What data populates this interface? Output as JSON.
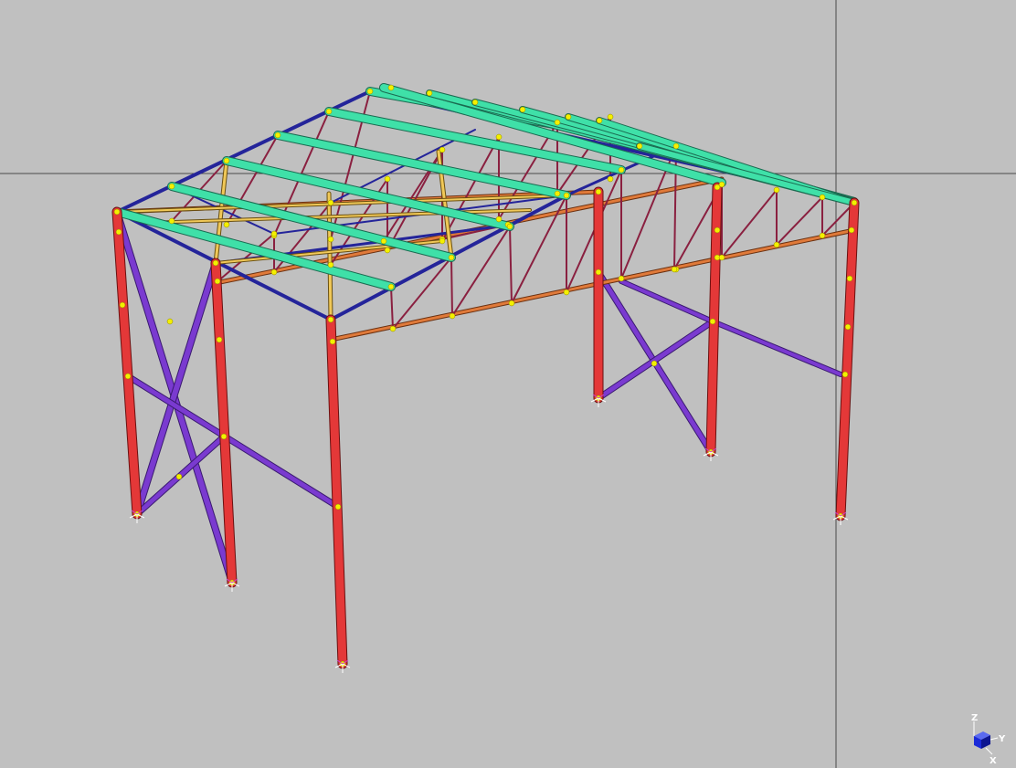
{
  "viewport": {
    "name": "3d-structure-view",
    "background": "#c0c0c0",
    "crosshair_color": "#4a4a4a"
  },
  "model": {
    "description_type": "steel-portal-frame-with-roof-trusses",
    "member_groups": {
      "columns": "#e43838",
      "column_edge": "#6a1010",
      "wall_bracing": "#7a3ad0",
      "roof_bracing": "#24249a",
      "purlins": "#3fe0a8",
      "purlin_edge": "#1a6a50",
      "truss_diagonals": "#8a2040",
      "bottom_chord": "#e07a3a",
      "tie_bars": "#f0c858",
      "nodes": "#f4f000",
      "supports": "#ffffff"
    }
  },
  "triad": {
    "labels": {
      "z": "Z",
      "y": "Y",
      "x": "X"
    },
    "cube_color": "#1a2ad8"
  }
}
